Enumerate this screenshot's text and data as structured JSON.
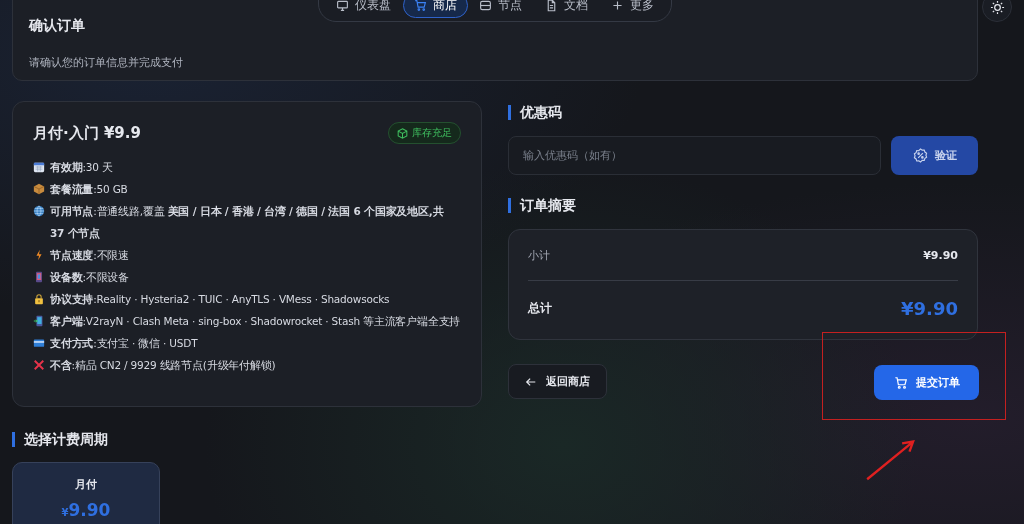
{
  "nav": {
    "items": [
      {
        "label": "仪表盘",
        "kind": "monitor",
        "selected": false
      },
      {
        "label": "商店",
        "kind": "cart",
        "selected": true
      },
      {
        "label": "节点",
        "kind": "server",
        "selected": false
      },
      {
        "label": "文档",
        "kind": "doc",
        "selected": false
      },
      {
        "label": "更多",
        "kind": "plus",
        "selected": false
      }
    ]
  },
  "header": {
    "title": "确认订单",
    "subtitle": "请确认您的订单信息并完成支付"
  },
  "plan": {
    "title": "月付·入门 ¥9.9",
    "badge": "库存充足",
    "features": [
      {
        "kind": "calendar",
        "text": "**有效期**:30 天"
      },
      {
        "kind": "package",
        "text": "**套餐流量**:50 GB"
      },
      {
        "kind": "globe",
        "text": "**可用节点**:普通线路,覆盖 **美国 / 日本 / 香港 / 台湾 / 德国 / 法国 6 个国家及地区,共 37 个节点**"
      },
      {
        "kind": "bolt",
        "text": "**节点速度**:不限速"
      },
      {
        "kind": "device",
        "text": "**设备数**:不限设备"
      },
      {
        "kind": "lock",
        "text": "**协议支持**:Reality · Hysteria2 · TUIC · AnyTLS · VMess · Shadowsocks"
      },
      {
        "kind": "client",
        "text": "**客户端**:V2rayN · Clash Meta · sing-box · Shadowrocket · Stash 等主流客户端全支持"
      },
      {
        "kind": "card",
        "text": "**支付方式**:支付宝 · 微信 · USDT"
      },
      {
        "kind": "cross",
        "text": "**不含**:精品 CN2 / 9929 线路节点(升级年付解锁)"
      }
    ]
  },
  "billing": {
    "title": "选择计费周期",
    "options": [
      {
        "label": "月付",
        "currency": "¥",
        "price": "9.90",
        "selected": true
      }
    ]
  },
  "coupon": {
    "title": "优惠码",
    "placeholder": "输入优惠码（如有）",
    "button": "验证"
  },
  "summary": {
    "title": "订单摘要",
    "subtotal_label": "小计",
    "subtotal": "¥9.90",
    "total_label": "总计",
    "total": "¥9.90"
  },
  "actions": {
    "back": "返回商店",
    "submit": "提交订单"
  }
}
